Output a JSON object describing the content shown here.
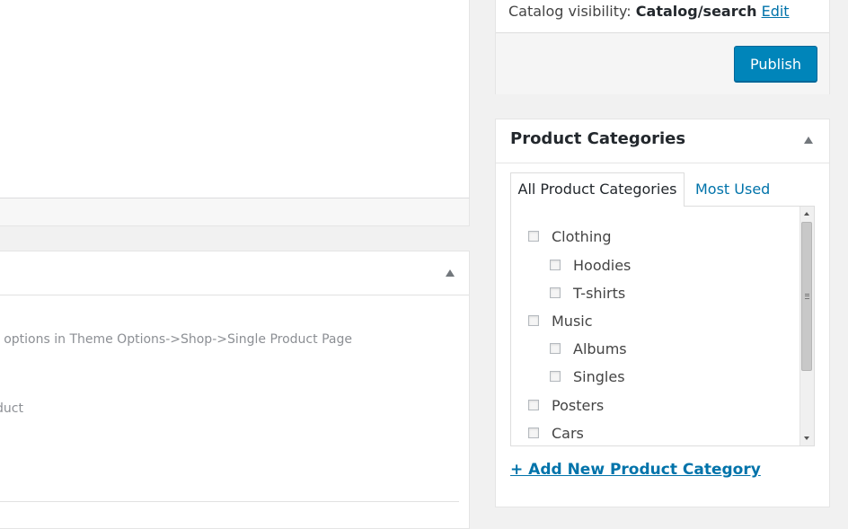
{
  "left_panel": {
    "meta_line1": "n. Set options in Theme Options->Shop->Single Product Page",
    "meta_line2": "roduct"
  },
  "publish": {
    "visibility_label": "Catalog visibility:",
    "visibility_value": "Catalog/search",
    "edit_link": "Edit",
    "publish_button": "Publish"
  },
  "categories": {
    "title": "Product Categories",
    "tabs": [
      "All Product Categories",
      "Most Used"
    ],
    "items": [
      {
        "label": "Clothing",
        "level": 0,
        "checked": false
      },
      {
        "label": "Hoodies",
        "level": 1,
        "checked": false
      },
      {
        "label": "T-shirts",
        "level": 1,
        "checked": false
      },
      {
        "label": "Music",
        "level": 0,
        "checked": false
      },
      {
        "label": "Albums",
        "level": 1,
        "checked": false
      },
      {
        "label": "Singles",
        "level": 1,
        "checked": false
      },
      {
        "label": "Posters",
        "level": 0,
        "checked": false
      },
      {
        "label": "Cars",
        "level": 0,
        "checked": false
      }
    ],
    "add_new_link": "+ Add New Product Category"
  },
  "colors": {
    "accent": "#0073aa",
    "button": "#0085ba",
    "background": "#f1f1f1"
  }
}
